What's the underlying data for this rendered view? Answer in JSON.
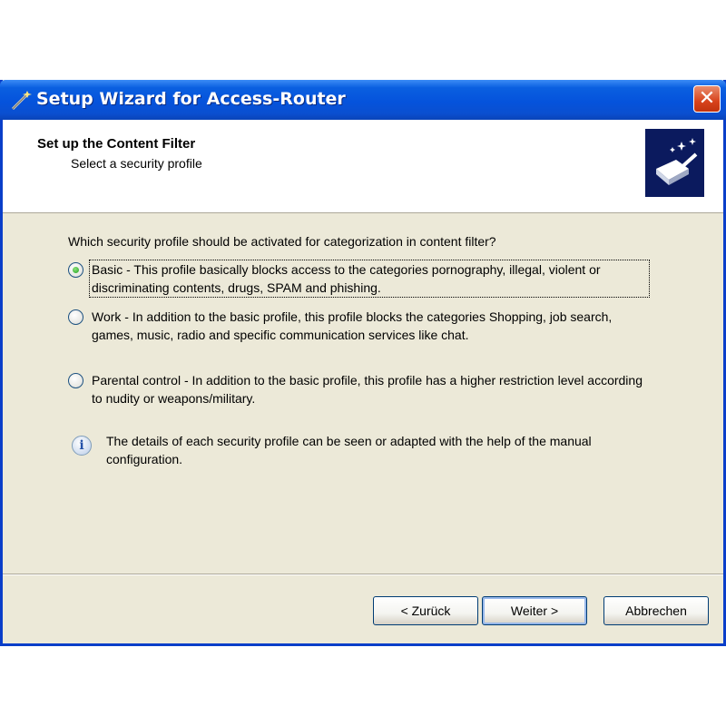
{
  "window": {
    "title": "Setup Wizard for Access-Router",
    "close_label": "✕"
  },
  "header": {
    "title": "Set up the Content Filter",
    "subtitle": "Select a security profile"
  },
  "content": {
    "question": "Which security profile should be activated for categorization in content filter?",
    "options": [
      {
        "label": "Basic - This profile basically blocks access to the categories pornography, illegal, violent or discriminating contents, drugs, SPAM and phishing.",
        "selected": true
      },
      {
        "label": "Work - In addition to the basic profile, this profile blocks the categories Shopping, job search, games, music, radio and specific communication services like chat.",
        "selected": false
      },
      {
        "label": "Parental control - In addition to the basic profile, this profile has a higher restriction level according to nudity or weapons/military.",
        "selected": false
      }
    ],
    "info_icon": "info-icon",
    "info_text": "The details of each security profile can be seen or adapted with the help of the manual configuration."
  },
  "buttons": {
    "back_label": "< Zurück",
    "next_label": "Weiter >",
    "cancel_label": "Abbrechen"
  },
  "colors": {
    "titlebar": "#0553dc",
    "dialog_bg": "#ece9d8",
    "close_button": "#d8431c"
  }
}
